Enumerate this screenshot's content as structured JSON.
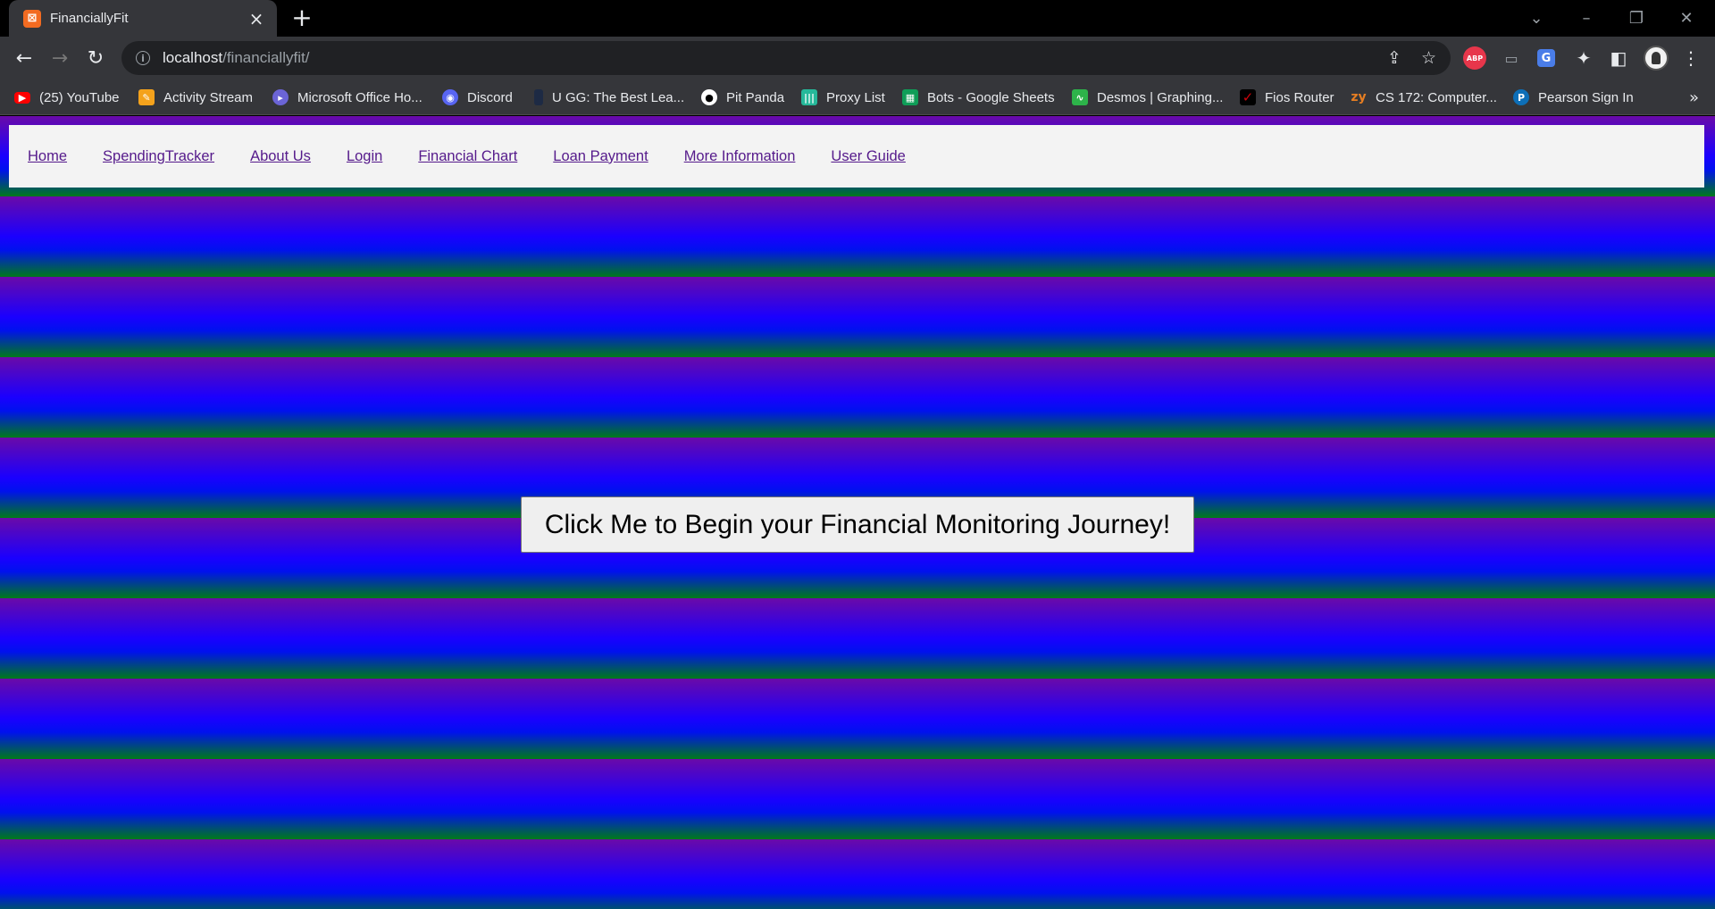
{
  "browser": {
    "tab_title": "FinanciallyFit",
    "url_host": "localhost",
    "url_path": "/financiallyfit/",
    "extensions": {
      "abp": "ABP"
    },
    "bookmarks": [
      {
        "label": "(25) YouTube",
        "icon": "youtube-icon",
        "color": "#ff0000"
      },
      {
        "label": "Activity Stream",
        "icon": "activity-stream-icon",
        "color": "#f4a21c"
      },
      {
        "label": "Microsoft Office Ho...",
        "icon": "office-icon",
        "color": "#6b64d6"
      },
      {
        "label": "Discord",
        "icon": "discord-icon",
        "color": "#5865f2"
      },
      {
        "label": "U GG: The Best Lea...",
        "icon": "ugg-icon",
        "color": "#1d2a44"
      },
      {
        "label": "Pit Panda",
        "icon": "panda-icon",
        "color": "#ffffff"
      },
      {
        "label": "Proxy List",
        "icon": "proxy-list-icon",
        "color": "#26b89a"
      },
      {
        "label": "Bots - Google Sheets",
        "icon": "google-sheets-icon",
        "color": "#0f9d58"
      },
      {
        "label": "Desmos | Graphing...",
        "icon": "desmos-icon",
        "color": "#2db34a"
      },
      {
        "label": "Fios Router",
        "icon": "verizon-icon",
        "color": "#cd040b"
      },
      {
        "label": "CS 172: Computer...",
        "icon": "zybooks-icon",
        "color": "#e67e22"
      },
      {
        "label": "Pearson Sign In",
        "icon": "pearson-icon",
        "color": "#0d6fb8"
      }
    ]
  },
  "site": {
    "nav": [
      {
        "label": "Home"
      },
      {
        "label": "SpendingTracker"
      },
      {
        "label": "About Us"
      },
      {
        "label": "Login"
      },
      {
        "label": "Financial Chart"
      },
      {
        "label": "Loan Payment"
      },
      {
        "label": "More Information"
      },
      {
        "label": "User Guide"
      }
    ],
    "cta_label": "Click Me to Begin your Financial Monitoring Journey!",
    "colors": {
      "link": "#551a8b",
      "stripe_purple": "#6a0aa8",
      "stripe_blue": "#1a00ff",
      "stripe_green": "#007a1a"
    }
  }
}
